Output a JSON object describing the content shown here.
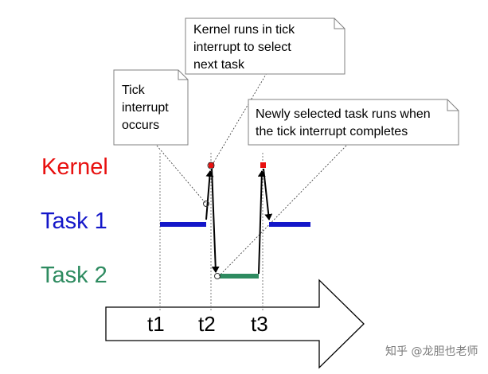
{
  "notes": {
    "tick": [
      "Tick",
      "interrupt",
      "occurs"
    ],
    "kernel": [
      "Kernel runs in tick",
      "interrupt to select",
      "next task"
    ],
    "newly": [
      "Newly selected task runs when",
      "the tick interrupt completes"
    ]
  },
  "rows": {
    "kernel": "Kernel",
    "task1": "Task 1",
    "task2": "Task 2"
  },
  "timeline": {
    "t1": "t1",
    "t2": "t2",
    "t3": "t3"
  },
  "watermark": "知乎 @龙胆也老师",
  "colors": {
    "kernel": "#e8100f",
    "task1": "#1417c9",
    "task2": "#2e8b60",
    "note_border": "#808080",
    "guide": "#7f7f7f"
  }
}
